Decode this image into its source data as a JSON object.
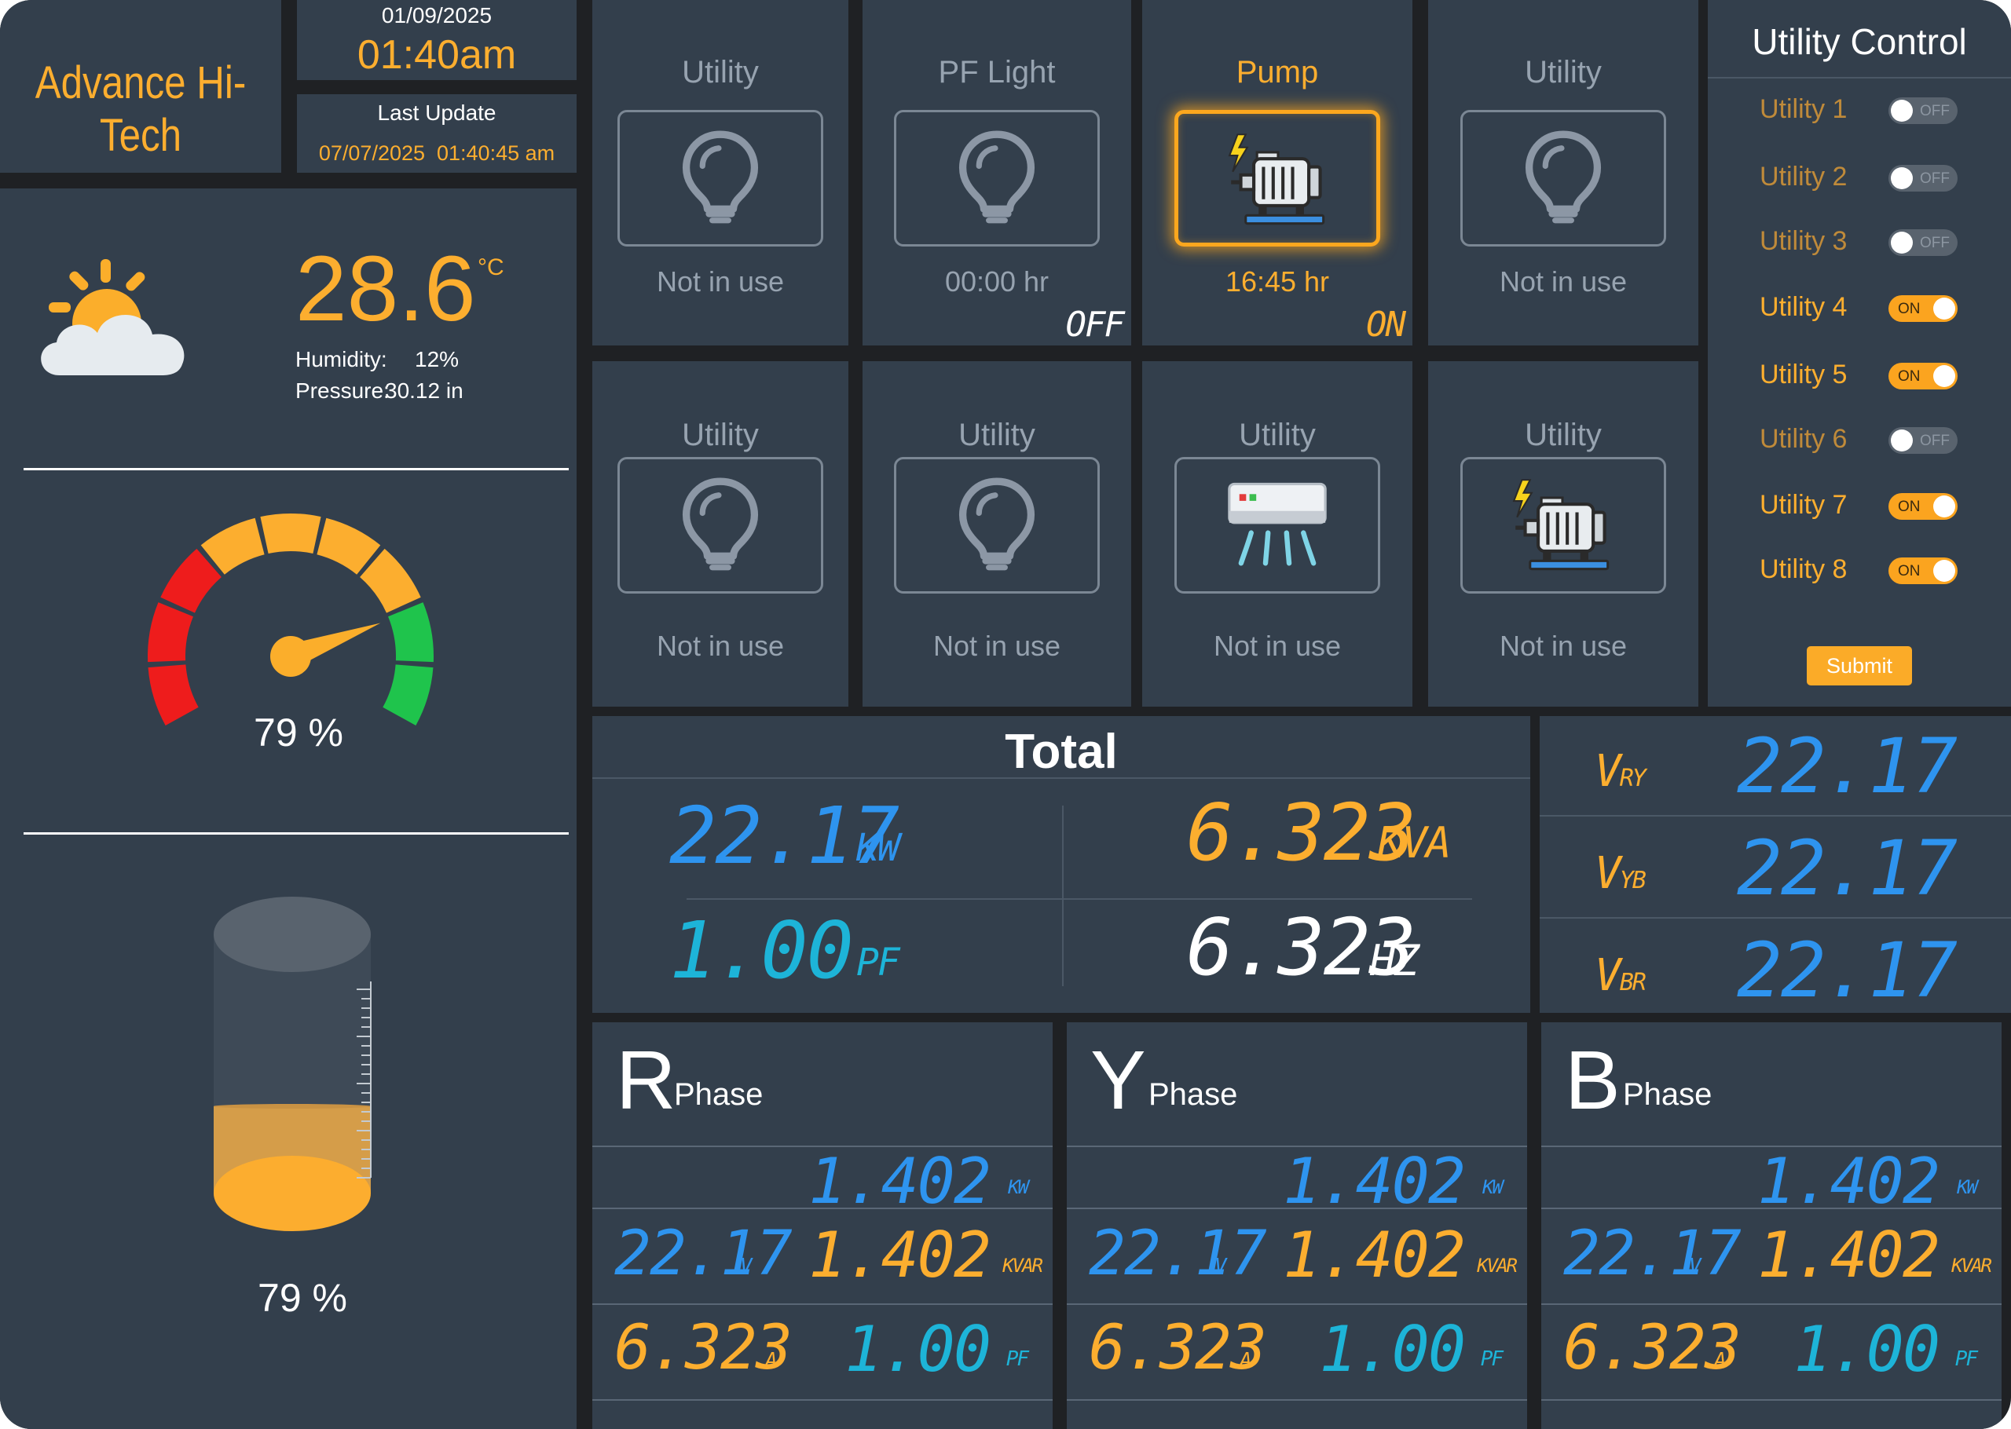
{
  "header": {
    "brand": "Advance Hi-Tech",
    "date": "01/09/2025",
    "time": "01:40am",
    "last_update_label": "Last Update",
    "last_update_value": "07/07/2025  01:40:45 am"
  },
  "weather": {
    "icon": "sun-cloud-icon",
    "temperature": "28.6",
    "unit": "°C",
    "humidity_label": "Humidity:",
    "humidity_value": "12%",
    "pressure_label": "Pressure:",
    "pressure_value": "30.12 in"
  },
  "gauge": {
    "percent": 79,
    "label": "79 %"
  },
  "tank": {
    "level_percent": 79,
    "label": "79 %"
  },
  "tiles": [
    {
      "title": "Utility",
      "icon": "light-bulb-icon",
      "status": "Not in use",
      "state": ""
    },
    {
      "title": "PF Light",
      "icon": "light-bulb-icon",
      "status": "00:00 hr",
      "state": "OFF"
    },
    {
      "title": "Pump",
      "icon": "motor-pump-icon",
      "status": "16:45 hr",
      "state": "ON"
    },
    {
      "title": "Utility",
      "icon": "light-bulb-icon",
      "status": "Not in use",
      "state": ""
    },
    {
      "title": "Utility",
      "icon": "light-bulb-icon",
      "status": "Not in use",
      "state": ""
    },
    {
      "title": "Utility",
      "icon": "light-bulb-icon",
      "status": "Not in use",
      "state": ""
    },
    {
      "title": "Utility",
      "icon": "air-conditioner-icon",
      "status": "Not in use",
      "state": ""
    },
    {
      "title": "Utility",
      "icon": "motor-pump-icon",
      "status": "Not in use",
      "state": ""
    }
  ],
  "utility_control": {
    "title": "Utility Control",
    "on_label": "ON",
    "off_label": "OFF",
    "items": [
      {
        "label": "Utility 1",
        "on": false
      },
      {
        "label": "Utility 2",
        "on": false
      },
      {
        "label": "Utility 3",
        "on": false
      },
      {
        "label": "Utility 4",
        "on": true
      },
      {
        "label": "Utility 5",
        "on": true
      },
      {
        "label": "Utility 6",
        "on": false
      },
      {
        "label": "Utility 7",
        "on": true
      },
      {
        "label": "Utility 8",
        "on": true
      }
    ],
    "submit_label": "Submit"
  },
  "total": {
    "title": "Total",
    "kw": "22.17",
    "kw_unit": "KW",
    "kva": "6.323",
    "kva_unit": "KVA",
    "pf": "1.00",
    "pf_unit": "PF",
    "hz": "6.323",
    "hz_unit": "HZ"
  },
  "line_voltages": [
    {
      "main": "V",
      "sub": "RY",
      "value": "22.17"
    },
    {
      "main": "V",
      "sub": "YB",
      "value": "22.17"
    },
    {
      "main": "V",
      "sub": "BR",
      "value": "22.17"
    }
  ],
  "phases": [
    {
      "letter": "R",
      "label": "Phase",
      "kw": "1.402",
      "kw_unit": "KW",
      "v": "22.17",
      "v_unit": "V",
      "kvar": "1.402",
      "kvar_unit": "KVAR",
      "a": "6.323",
      "a_unit": "A",
      "pf": "1.00",
      "pf_unit": "PF"
    },
    {
      "letter": "Y",
      "label": "Phase",
      "kw": "1.402",
      "kw_unit": "KW",
      "v": "22.17",
      "v_unit": "V",
      "kvar": "1.402",
      "kvar_unit": "KVAR",
      "a": "6.323",
      "a_unit": "A",
      "pf": "1.00",
      "pf_unit": "PF"
    },
    {
      "letter": "B",
      "label": "Phase",
      "kw": "1.402",
      "kw_unit": "KW",
      "v": "22.17",
      "v_unit": "V",
      "kvar": "1.402",
      "kvar_unit": "KVAR",
      "a": "6.323",
      "a_unit": "A",
      "pf": "1.00",
      "pf_unit": "PF"
    }
  ],
  "colors": {
    "accent": "#fcae2f",
    "panel": "#333f4c",
    "gauge_red": "#ee1c1c",
    "gauge_orange": "#fcae2f",
    "gauge_green": "#1fc44c",
    "blue_value": "#2e94ef",
    "cyan_value": "#1db4d8"
  }
}
